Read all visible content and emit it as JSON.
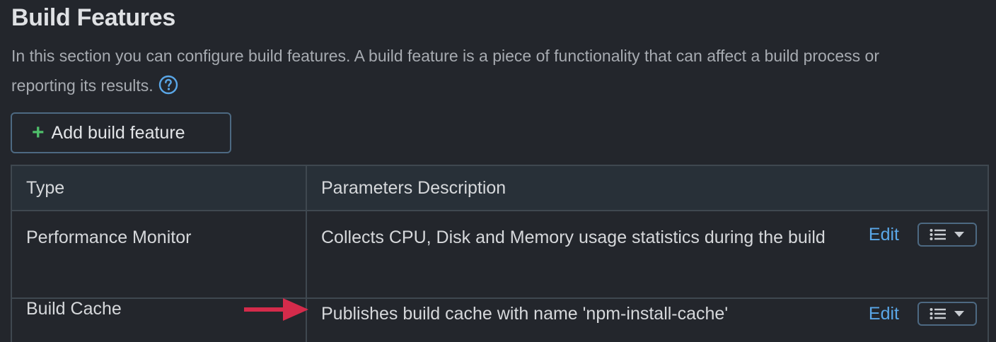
{
  "section": {
    "title": "Build Features",
    "description": "In this section you can configure build features. A build feature is a piece of functionality that can affect a build process or reporting its results."
  },
  "add_button": {
    "icon": "plus-icon",
    "label": "Add build feature"
  },
  "table": {
    "headers": [
      "Type",
      "Parameters Description"
    ],
    "rows": [
      {
        "type": "Performance Monitor",
        "description": "Collects CPU, Disk and Memory usage statistics during the build",
        "edit_label": "Edit"
      },
      {
        "type": "Build Cache",
        "description": "Publishes build cache with name 'npm-install-cache'",
        "edit_label": "Edit"
      }
    ]
  },
  "colors": {
    "background": "#23262c",
    "accent_link": "#5aa7e8",
    "plus_green": "#4fbf6a",
    "annotation_arrow": "#d42b4b"
  }
}
